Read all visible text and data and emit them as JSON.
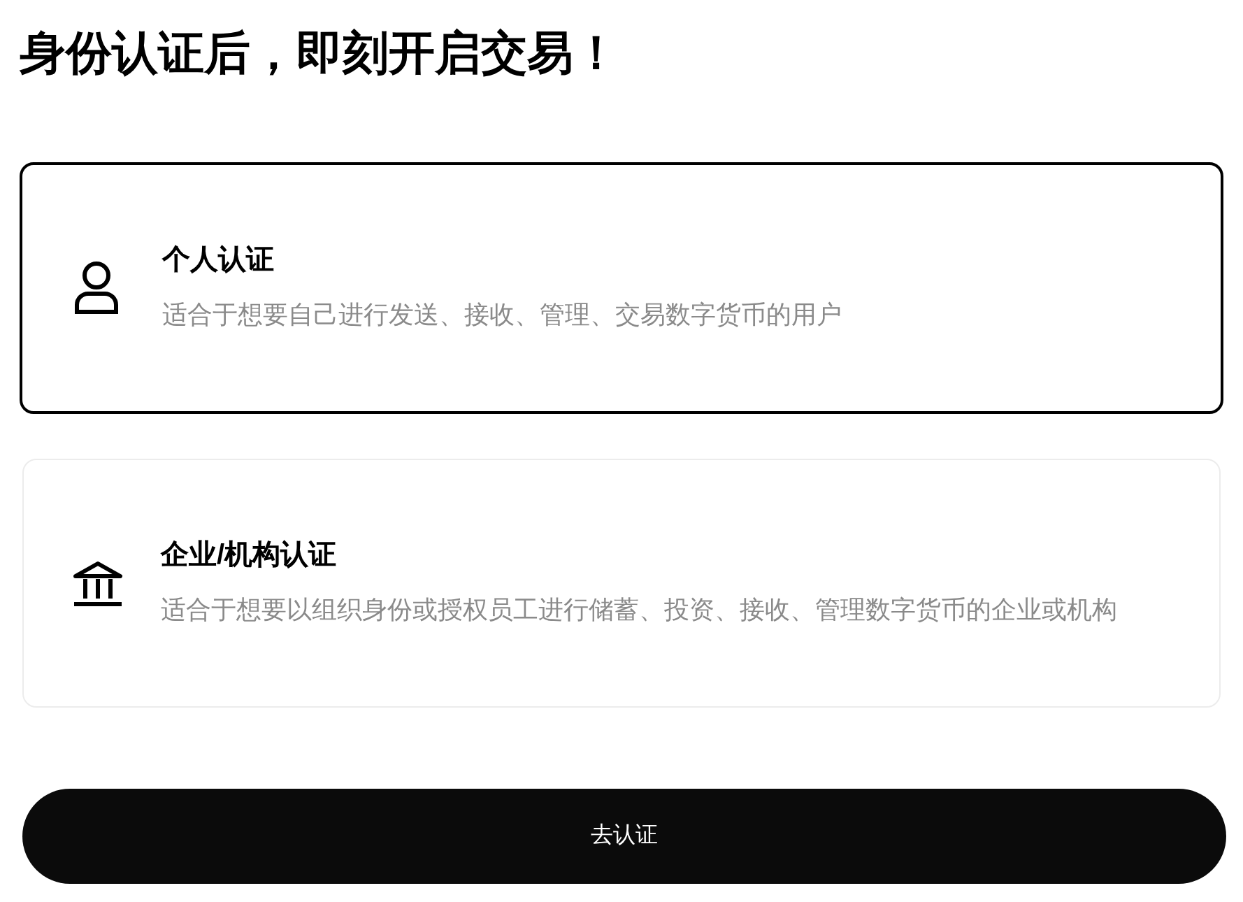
{
  "title": "身份认证后，即刻开启交易！",
  "options": [
    {
      "kind": "person",
      "name": "个人认证",
      "description": "适合于想要自己进行发送、接收、管理、交易数字货币的用户",
      "selected": true
    },
    {
      "kind": "institution",
      "name": "企业/机构认证",
      "description": "适合于想要以组织身份或授权员工进行储蓄、投资、接收、管理数字货币的企业或机构",
      "selected": false
    }
  ],
  "submit_button": "去认证"
}
